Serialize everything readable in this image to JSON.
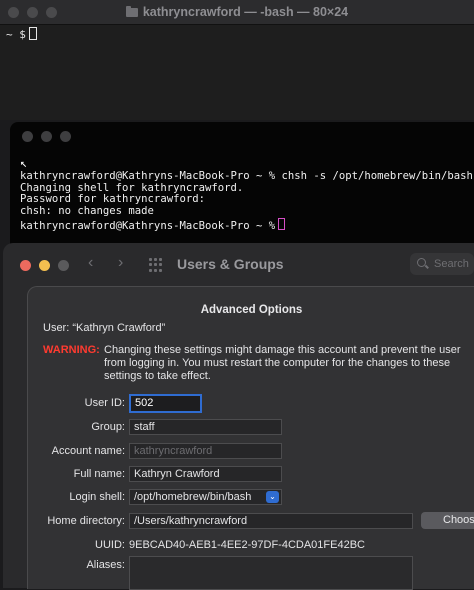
{
  "terminal_back": {
    "title": "kathryncrawford — -bash — 80×24",
    "prompt": "~ $"
  },
  "terminal_front": {
    "lines": [
      "kathryncrawford@Kathryns-MacBook-Pro ~ % chsh -s /opt/homebrew/bin/bash",
      "Changing shell for kathryncrawford.",
      "Password for kathryncrawford:",
      "chsh: no changes made",
      "kathryncrawford@Kathryns-MacBook-Pro ~ %"
    ],
    "cursor_color": "#d64fc6"
  },
  "settings_window": {
    "title": "Users & Groups",
    "search_placeholder": "Search",
    "icons": [
      "back-chevron-icon",
      "forward-chevron-icon",
      "grid-icon",
      "search-icon"
    ]
  },
  "advanced_options": {
    "title": "Advanced Options",
    "user_line": "User:  “Kathryn Crawford”",
    "warning_label": "WARNING:",
    "warning_text": "Changing these settings might damage this account and prevent the user from logging in. You must restart the computer for the changes to these settings to take effect.",
    "fields": {
      "user_id": {
        "label": "User ID:",
        "value": "502"
      },
      "group": {
        "label": "Group:",
        "value": "staff"
      },
      "account_name": {
        "label": "Account name:",
        "value": "kathryncrawford"
      },
      "full_name": {
        "label": "Full name:",
        "value": "Kathryn Crawford"
      },
      "login_shell": {
        "label": "Login shell:",
        "value": "/opt/homebrew/bin/bash"
      },
      "home_directory": {
        "label": "Home directory:",
        "value": "/Users/kathryncrawford"
      },
      "uuid": {
        "label": "UUID:",
        "value": "9EBCAD40-AEB1-4EE2-97DF-4CDA01FE42BC"
      },
      "aliases": {
        "label": "Aliases:"
      }
    },
    "choose_button": "Choos",
    "accent_color": "#2f6cd1",
    "warning_color": "#ff3b30"
  }
}
